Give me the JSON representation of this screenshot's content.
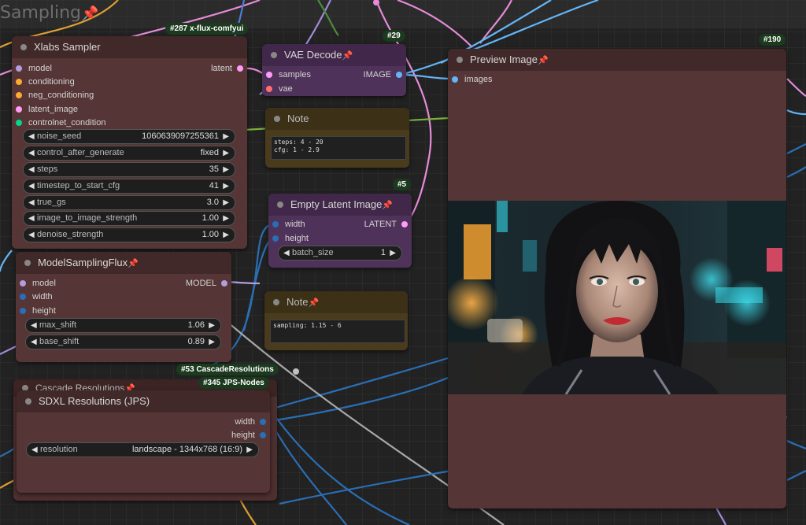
{
  "group": {
    "title": "Sampling",
    "pin": "📌"
  },
  "badges": {
    "xflux": "#287 x-flux-comfyui",
    "vae": "#29",
    "preview": "#190",
    "empty": "#5",
    "cascade": "#53 CascadeResolutions",
    "jps": "#345 JPS-Nodes"
  },
  "xlabs": {
    "title": "Xlabs Sampler",
    "inputs": [
      "model",
      "conditioning",
      "neg_conditioning",
      "latent_image",
      "controlnet_condition"
    ],
    "output": "latent",
    "widgets": [
      {
        "label": "noise_seed",
        "value": "1060639097255361"
      },
      {
        "label": "control_after_generate",
        "value": "fixed"
      },
      {
        "label": "steps",
        "value": "35"
      },
      {
        "label": "timestep_to_start_cfg",
        "value": "41"
      },
      {
        "label": "true_gs",
        "value": "3.0"
      },
      {
        "label": "image_to_image_strength",
        "value": "1.00"
      },
      {
        "label": "denoise_strength",
        "value": "1.00"
      }
    ]
  },
  "vae": {
    "title": "VAE Decode",
    "inputs": [
      "samples",
      "vae"
    ],
    "output": "IMAGE"
  },
  "note1": {
    "title": "Note",
    "text": "steps: 4 - 20\ncfg: 1 - 2.9"
  },
  "empty": {
    "title": "Empty Latent Image",
    "inputs": [
      "width",
      "height"
    ],
    "output": "LATENT",
    "widget": {
      "label": "batch_size",
      "value": "1"
    }
  },
  "note2": {
    "title": "Note",
    "text": "sampling: 1.15 - 6"
  },
  "msf": {
    "title": "ModelSamplingFlux",
    "inputs": [
      "model",
      "width",
      "height"
    ],
    "output": "MODEL",
    "widgets": [
      {
        "label": "max_shift",
        "value": "1.06"
      },
      {
        "label": "base_shift",
        "value": "0.89"
      }
    ]
  },
  "cascade": {
    "title": "Cascade Resolutions"
  },
  "sdxl": {
    "title": "SDXL Resolutions (JPS)",
    "outputs": [
      "width",
      "height"
    ],
    "widget": {
      "label": "resolution",
      "value": "landscape - 1344x768 (16:9)"
    }
  },
  "preview": {
    "title": "Preview Image",
    "input": "images"
  },
  "colors": {
    "model": "#b39ddb",
    "conditioning": "#ffa931",
    "latent": "#ff9cf9",
    "controlnet": "#00d78d",
    "image": "#64b5f6",
    "vae": "#ff6e6e",
    "int": "#2a6eb5"
  }
}
